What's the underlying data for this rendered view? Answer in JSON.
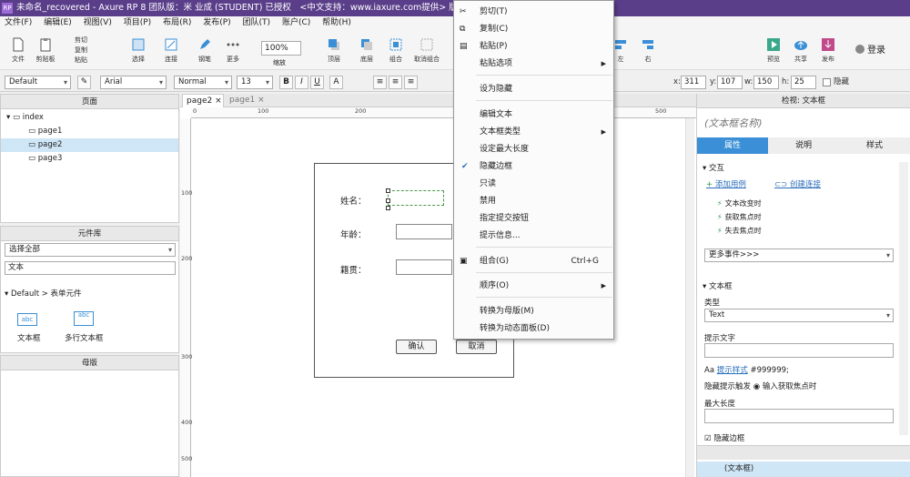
{
  "title": "未命名_recovered - Axure RP 8 团队版：米 业成 (STUDENT) 已授权　<中文支持：www.iaxure.com提供> 版本：V1.4.2",
  "app_icon": "RP",
  "menu": [
    "文件(F)",
    "编辑(E)",
    "视图(V)",
    "项目(P)",
    "布局(R)",
    "发布(P)",
    "团队(T)",
    "账户(C)",
    "帮助(H)"
  ],
  "toolbar": {
    "file": "文件",
    "clipboard": "剪贴板",
    "cut": "剪切",
    "copy": "复制",
    "paste": "粘贴",
    "select": "选择",
    "connect": "连接",
    "pen": "钢笔",
    "more": "更多",
    "zoom": "100%",
    "zoom_label": "缩放",
    "top": "顶层",
    "bottom": "底层",
    "group": "组合",
    "ungroup": "取消组合",
    "left": "左",
    "right": "右",
    "preview": "预览",
    "share": "共享",
    "publish": "发布",
    "login": "登录"
  },
  "format": {
    "style": "Default",
    "font": "Arial",
    "weight": "Normal",
    "size": "13",
    "x_label": "x:",
    "x": "311",
    "y_label": "y:",
    "y": "107",
    "w_label": "w:",
    "w": "150",
    "h_label": "h:",
    "h": "25",
    "hide_label": "隐藏"
  },
  "pages_panel": {
    "title": "页面",
    "items": [
      "index",
      "page1",
      "page2",
      "page3"
    ]
  },
  "library_panel": {
    "title": "元件库",
    "select": "选择全部",
    "search": "文本",
    "group": "Default > 表单元件",
    "items": [
      "文本框",
      "多行文本框"
    ],
    "icon_text": "abc"
  },
  "master_panel": {
    "title": "母版"
  },
  "tabs": [
    "page2",
    "page1"
  ],
  "ruler_h": [
    "0",
    "100",
    "200",
    "300",
    "400",
    "500"
  ],
  "ruler_v": [
    "100",
    "200",
    "300",
    "400",
    "500"
  ],
  "form": {
    "name": "姓名：",
    "age": "年龄：",
    "origin": "籍贯：",
    "ok": "确认",
    "cancel": "取消"
  },
  "context_menu": [
    {
      "label": "剪切(T)",
      "icon": "scissors-icon"
    },
    {
      "label": "复制(C)",
      "icon": "copy-icon"
    },
    {
      "label": "粘贴(P)",
      "icon": "paste-icon"
    },
    {
      "label": "粘贴选项",
      "arrow": true
    },
    {
      "label": "设为隐藏"
    },
    {
      "label": "编辑文本"
    },
    {
      "label": "文本框类型",
      "arrow": true
    },
    {
      "label": "设定最大长度"
    },
    {
      "label": "隐藏边框",
      "checked": true
    },
    {
      "label": "只读"
    },
    {
      "label": "禁用"
    },
    {
      "label": "指定提交按钮"
    },
    {
      "label": "提示信息..."
    },
    {
      "label": "组合(G)",
      "shortcut": "Ctrl+G",
      "icon": "group-icon"
    },
    {
      "label": "顺序(O)",
      "arrow": true
    },
    {
      "label": "转换为母版(M)"
    },
    {
      "label": "转换为动态面板(D)"
    }
  ],
  "inspector": {
    "title": "检视: 文本框",
    "name_placeholder": "(文本框名称)",
    "tabs": [
      "属性",
      "说明",
      "样式"
    ],
    "interaction": "交互",
    "add_case": "添加用例",
    "create_link": "创建连接",
    "events": [
      "文本改变时",
      "获取焦点时",
      "失去焦点时"
    ],
    "more_events": "更多事件>>>",
    "textbox_section": "文本框",
    "type_label": "类型",
    "type_value": "Text",
    "hint_label": "提示文字",
    "hint_style": "提示样式",
    "hint_color": "#999999;",
    "hint_trigger": "隐藏提示触发",
    "hint_option": "输入获取焦点时",
    "maxlen_label": "最大长度",
    "hide_border": "隐藏边框",
    "bottom_item": "(文本框)"
  },
  "colors": {
    "accent": "#3a8fd6",
    "title_bg": "#5a3e8a"
  }
}
